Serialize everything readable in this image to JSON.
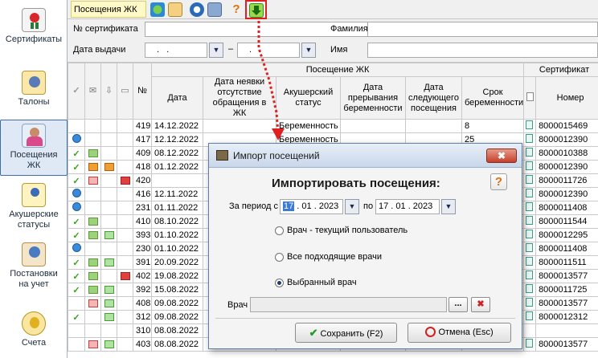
{
  "sidebar": {
    "items": [
      {
        "label": "Сертификаты",
        "icon": "certificate-icon"
      },
      {
        "label": "Талоны",
        "icon": "coupon-icon"
      },
      {
        "label": "Посещения ЖК",
        "icon": "visits-icon",
        "selected": true
      },
      {
        "label": "Акушерские статусы",
        "icon": "obstetric-status-icon"
      },
      {
        "label": "Постановки на учет",
        "icon": "registration-icon"
      },
      {
        "label": "Счета",
        "icon": "invoices-icon"
      }
    ]
  },
  "toolbar": {
    "title": "Посещения ЖК"
  },
  "filter": {
    "cert_label": "№ сертификата",
    "surname_label": "Фамилия",
    "issue_date_label": "Дата выдачи",
    "date_from": " .  . ",
    "date_to": " .  . ",
    "dash": "–",
    "name_label": "Имя"
  },
  "grid": {
    "group_visits": "Посещение ЖК",
    "group_cert": "Сертификат",
    "headers": {
      "num": "№",
      "date": "Дата",
      "no_show": "Дата неявки отсутствие обращения в ЖК",
      "status": "Акушерский статус",
      "termination": "Дата прерывания беременности",
      "next_visit": "Дата следующего посещения",
      "term": "Срок беременности",
      "cert_number": "Номер"
    },
    "rows": [
      {
        "c1": "",
        "c2": "",
        "c3": "",
        "c4": "",
        "num": "419",
        "date": "14.12.2022",
        "status": "Беременность",
        "term": "8",
        "cert": "8000015469"
      },
      {
        "c1": "globe",
        "c2": "",
        "c3": "",
        "c4": "",
        "num": "417",
        "date": "12.12.2022",
        "status": "Беременность",
        "term": "25",
        "cert": "8000012390"
      },
      {
        "c1": "check",
        "c2": "mail",
        "c3": "",
        "c4": "",
        "num": "409",
        "date": "08.12.2022",
        "status": "",
        "term": "",
        "cert": "8000010388"
      },
      {
        "c1": "check",
        "c2": "mail-o",
        "c3": "orange",
        "c4": "",
        "num": "418",
        "date": "01.12.2022",
        "status": "",
        "term": "",
        "cert": "8000012390"
      },
      {
        "c1": "check",
        "c2": "mail-r",
        "c3": "",
        "c4": "minus",
        "num": "420",
        "date": "",
        "status": "",
        "term": "",
        "cert": "8000011726"
      },
      {
        "c1": "globe",
        "c2": "",
        "c3": "",
        "c4": "",
        "num": "416",
        "date": "12.11.2022",
        "status": "",
        "term": "",
        "cert": "8000012390"
      },
      {
        "c1": "globe",
        "c2": "",
        "c3": "",
        "c4": "",
        "num": "231",
        "date": "01.11.2022",
        "status": "",
        "term": "",
        "cert": "8000011408"
      },
      {
        "c1": "check",
        "c2": "mail",
        "c3": "",
        "c4": "",
        "num": "410",
        "date": "08.10.2022",
        "status": "",
        "term": "",
        "cert": "8000011544"
      },
      {
        "c1": "check",
        "c2": "mail",
        "c3": "box",
        "c4": "",
        "num": "393",
        "date": "01.10.2022",
        "status": "",
        "term": "",
        "cert": "8000012295"
      },
      {
        "c1": "globe",
        "c2": "",
        "c3": "",
        "c4": "",
        "num": "230",
        "date": "01.10.2022",
        "status": "",
        "term": "",
        "cert": "8000011408"
      },
      {
        "c1": "check",
        "c2": "mail",
        "c3": "box",
        "c4": "",
        "num": "391",
        "date": "20.09.2022",
        "status": "",
        "term": "",
        "cert": "8000011511"
      },
      {
        "c1": "check",
        "c2": "mail",
        "c3": "",
        "c4": "minus",
        "num": "402",
        "date": "19.08.2022",
        "status": "",
        "term": "",
        "cert": "8000013577"
      },
      {
        "c1": "check",
        "c2": "mail",
        "c3": "box",
        "c4": "",
        "num": "392",
        "date": "15.08.2022",
        "status": "",
        "term": "",
        "cert": "8000011725"
      },
      {
        "c1": "",
        "c2": "mail-r",
        "c3": "box",
        "c4": "",
        "num": "408",
        "date": "09.08.2022",
        "status": "",
        "term": "",
        "cert": "8000013577"
      },
      {
        "c1": "check",
        "c2": "",
        "c3": "box",
        "c4": "",
        "num": "312",
        "date": "09.08.2022",
        "status": "",
        "term": "",
        "cert": "8000012312"
      },
      {
        "c1": "",
        "c2": "",
        "c3": "",
        "c4": "",
        "num": "310",
        "date": "08.08.2022",
        "status": "",
        "term": "",
        "cert": ""
      },
      {
        "c1": "",
        "c2": "mail-r",
        "c3": "box",
        "c4": "",
        "num": "403",
        "date": "08.08.2022",
        "status": "",
        "term": "",
        "cert": "8000013577"
      }
    ]
  },
  "dialog": {
    "title": "Импорт посещений",
    "close": "✖",
    "heading": "Импортировать посещения:",
    "help": "?",
    "period_label": "За период с",
    "date_from_day": "17",
    "date_from_rest": " . 01 . 2023",
    "to_label": "по",
    "date_to": "17 . 01 . 2023",
    "radio_current": "Врач - текущий пользователь",
    "radio_all": "Все подходящие врачи",
    "radio_selected": "Выбранный врач",
    "doctor_label": "Врач",
    "browse": "...",
    "clear": "✖",
    "save": "Сохранить (F2)",
    "cancel": "Отмена (Esc)"
  }
}
